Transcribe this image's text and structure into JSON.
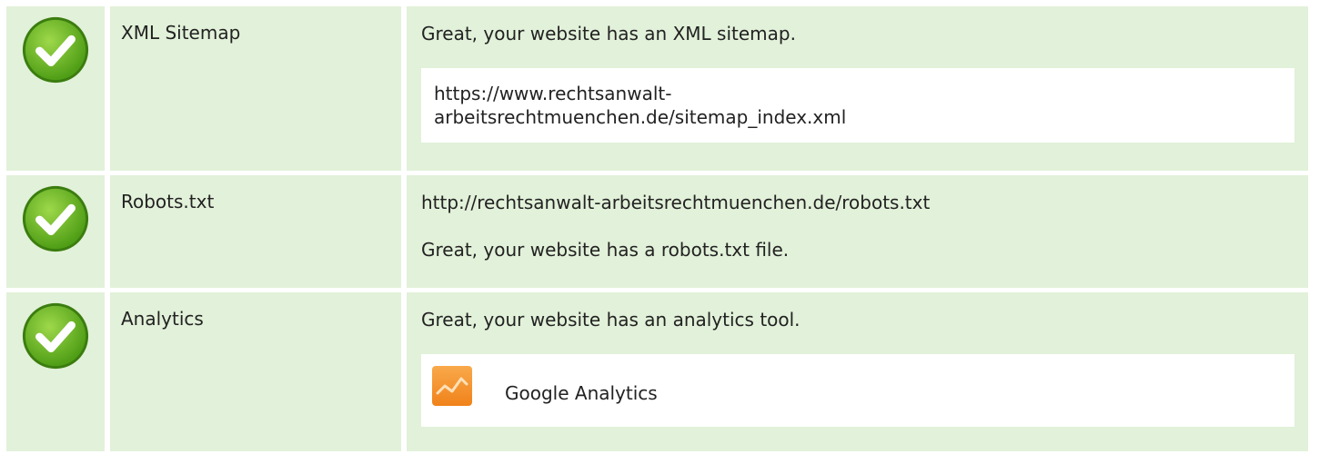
{
  "rows": [
    {
      "name": "XML Sitemap",
      "status": "Great, your website has an XML sitemap.",
      "url_line1": "https://www.rechtsanwalt-",
      "url_line2": "arbeitsrechtmuenchen.de/sitemap_index.xml",
      "icon": "check-circle-icon"
    },
    {
      "name": "Robots.txt",
      "url": "http://rechtsanwalt-arbeitsrechtmuenchen.de/robots.txt",
      "status": "Great, your website has a robots.txt file.",
      "icon": "check-circle-icon"
    },
    {
      "name": "Analytics",
      "status": "Great, your website has an analytics tool.",
      "tool_name": "Google Analytics",
      "tool_icon": "google-analytics-icon",
      "icon": "check-circle-icon"
    }
  ],
  "colors": {
    "row_bg": "#e2f1d9",
    "check_green": "#6fbf2a",
    "analytics_orange": "#f7941d"
  }
}
